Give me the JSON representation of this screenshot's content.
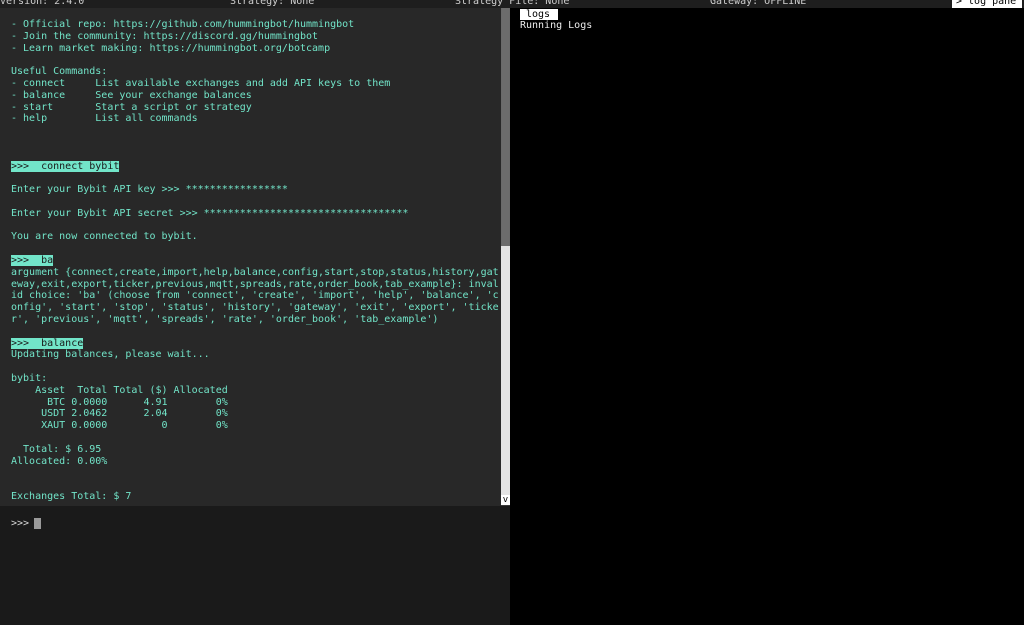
{
  "topbar": {
    "version": "Version: 2.4.0",
    "strategy": "Strategy: None",
    "strategy_file": "Strategy File: None",
    "gateway": "Gateway: OFFLINE",
    "log_pane": "> log pane"
  },
  "output": {
    "lines": [
      "- Official repo: https://github.com/hummingbot/hummingbot",
      "- Join the community: https://discord.gg/hummingbot",
      "- Learn market making: https://hummingbot.org/botcamp",
      "",
      "Useful Commands:",
      "- connect     List available exchanges and add API keys to them",
      "- balance     See your exchange balances",
      "- start       Start a script or strategy",
      "- help        List all commands",
      "",
      "",
      "",
      ">>>  connect bybit",
      "",
      "Enter your Bybit API key >>> *****************",
      "",
      "Enter your Bybit API secret >>> **********************************",
      "",
      "You are now connected to bybit.",
      "",
      ">>>  ba",
      "argument {connect,create,import,help,balance,config,start,stop,status,history,gat",
      "eway,exit,export,ticker,previous,mqtt,spreads,rate,order_book,tab_example}: inval",
      "id choice: 'ba' (choose from 'connect', 'create', 'import', 'help', 'balance', 'c",
      "onfig', 'start', 'stop', 'status', 'history', 'gateway', 'exit', 'export', 'ticke",
      "r', 'previous', 'mqtt', 'spreads', 'rate', 'order_book', 'tab_example')",
      "",
      ">>>  balance",
      "Updating balances, please wait...",
      "",
      "bybit:",
      "    Asset  Total Total ($) Allocated",
      "      BTC 0.0000      4.91        0%",
      "     USDT 2.0462      2.04        0%",
      "     XAUT 0.0000         0        0%",
      "",
      "  Total: $ 6.95",
      "Allocated: 0.00%",
      "",
      "",
      "Exchanges Total: $ 7"
    ],
    "highlighted": [
      12,
      20,
      27
    ]
  },
  "input": {
    "prompt": ">>>"
  },
  "scrollbar": {
    "arrow": "v"
  },
  "log_pane": {
    "tab_label": "logs",
    "title": "Running Logs"
  }
}
